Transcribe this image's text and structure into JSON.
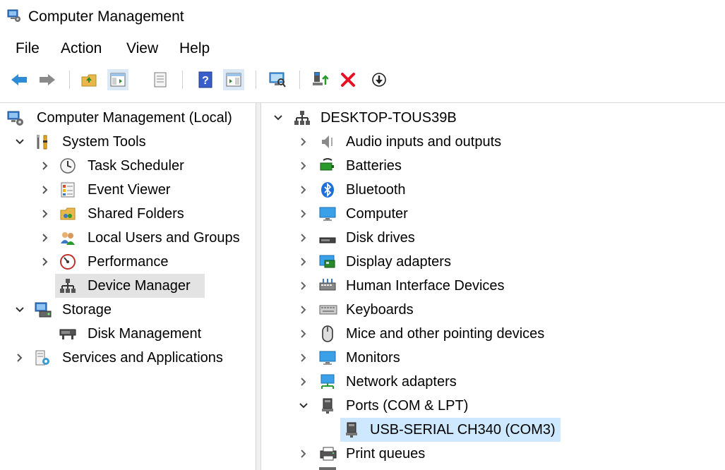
{
  "window": {
    "title": "Computer Management"
  },
  "menu": {
    "items": [
      "File",
      "Action",
      "View",
      "Help"
    ]
  },
  "left_tree": {
    "root": "Computer Management (Local)",
    "system_tools": "System Tools",
    "task_scheduler": "Task Scheduler",
    "event_viewer": "Event Viewer",
    "shared_folders": "Shared Folders",
    "local_users": "Local Users and Groups",
    "performance": "Performance",
    "device_manager": "Device Manager",
    "storage": "Storage",
    "disk_management": "Disk Management",
    "services_apps": "Services and Applications"
  },
  "right_tree": {
    "computer_name": "DESKTOP-TOUS39B",
    "categories": [
      "Audio inputs and outputs",
      "Batteries",
      "Bluetooth",
      "Computer",
      "Disk drives",
      "Display adapters",
      "Human Interface Devices",
      "Keyboards",
      "Mice and other pointing devices",
      "Monitors",
      "Network adapters",
      "Ports (COM & LPT)",
      "Print queues"
    ],
    "port_device": "USB-SERIAL CH340 (COM3)"
  },
  "colors": {
    "selection_gray": "#e3e3e3",
    "selection_blue": "#cde8ff",
    "nav_arrow": "#2e8bd6",
    "delete_red": "#e81123"
  }
}
